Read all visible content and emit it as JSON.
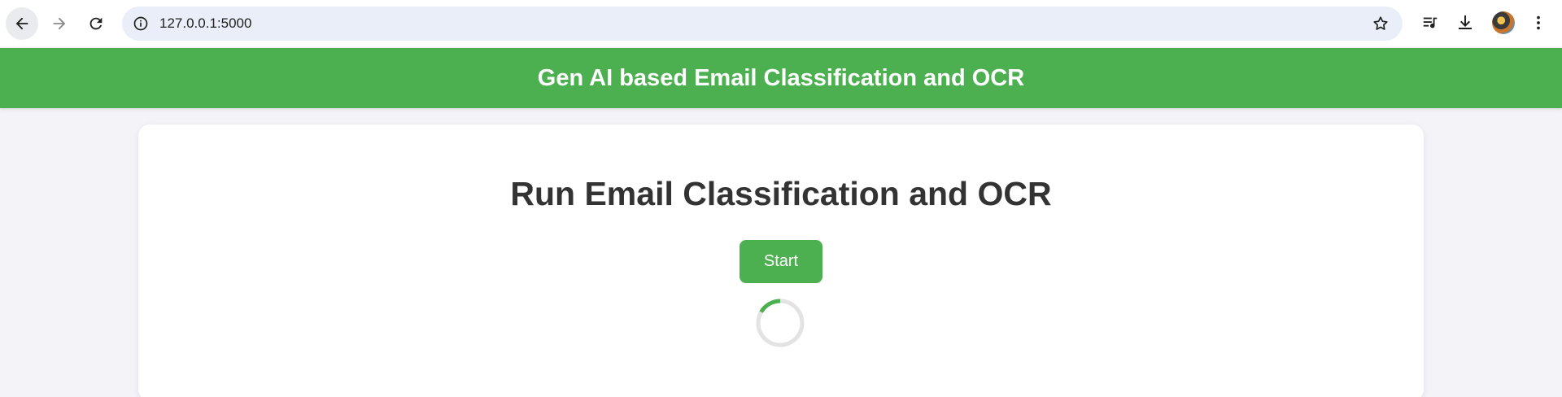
{
  "browser": {
    "url": "127.0.0.1:5000",
    "icons": {
      "back": "arrow-left-icon",
      "forward": "arrow-right-icon",
      "reload": "reload-icon",
      "info": "info-icon",
      "bookmark": "star-icon",
      "media": "media-control-icon",
      "download": "download-icon",
      "menu": "kebab-menu-icon"
    }
  },
  "header": {
    "title": "Gen AI based Email Classification and OCR"
  },
  "main": {
    "heading": "Run Email Classification and OCR",
    "start_label": "Start",
    "loading": true
  },
  "colors": {
    "accent": "#4caf50",
    "background": "#f3f3f8",
    "card": "#ffffff",
    "text": "#333333"
  }
}
